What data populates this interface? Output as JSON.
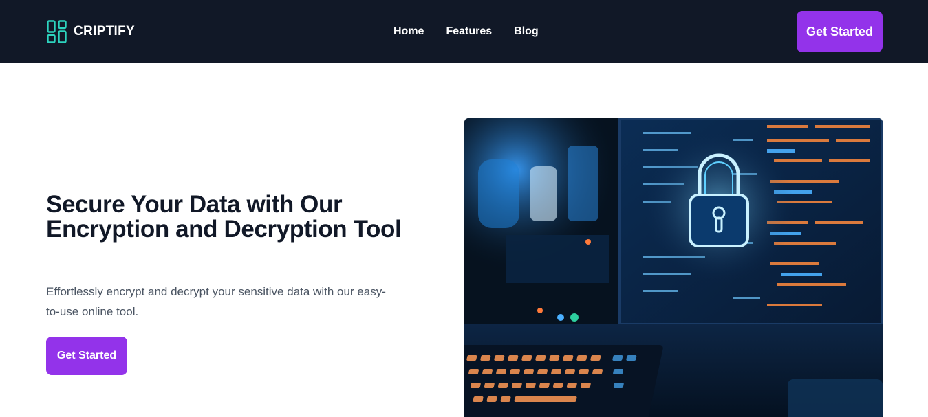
{
  "brand": {
    "name": "CRIPTIFY",
    "icon": "layout-grid-icon",
    "icon_color": "#2dd4bf"
  },
  "nav": {
    "links": [
      "Home",
      "Features",
      "Blog"
    ],
    "cta_label": "Get Started"
  },
  "hero": {
    "title": "Secure Your Data with Our Encryption and Decryption Tool",
    "subtitle": "Effortlessly encrypt and decrypt your sensitive data with our easy-to-use online tool.",
    "cta_label": "Get Started",
    "image": "cybersecurity-padlock-monitor-image"
  },
  "colors": {
    "navbar_bg": "#111827",
    "accent": "#9333ea",
    "title_text": "#111827",
    "body_text": "#4b5563"
  }
}
